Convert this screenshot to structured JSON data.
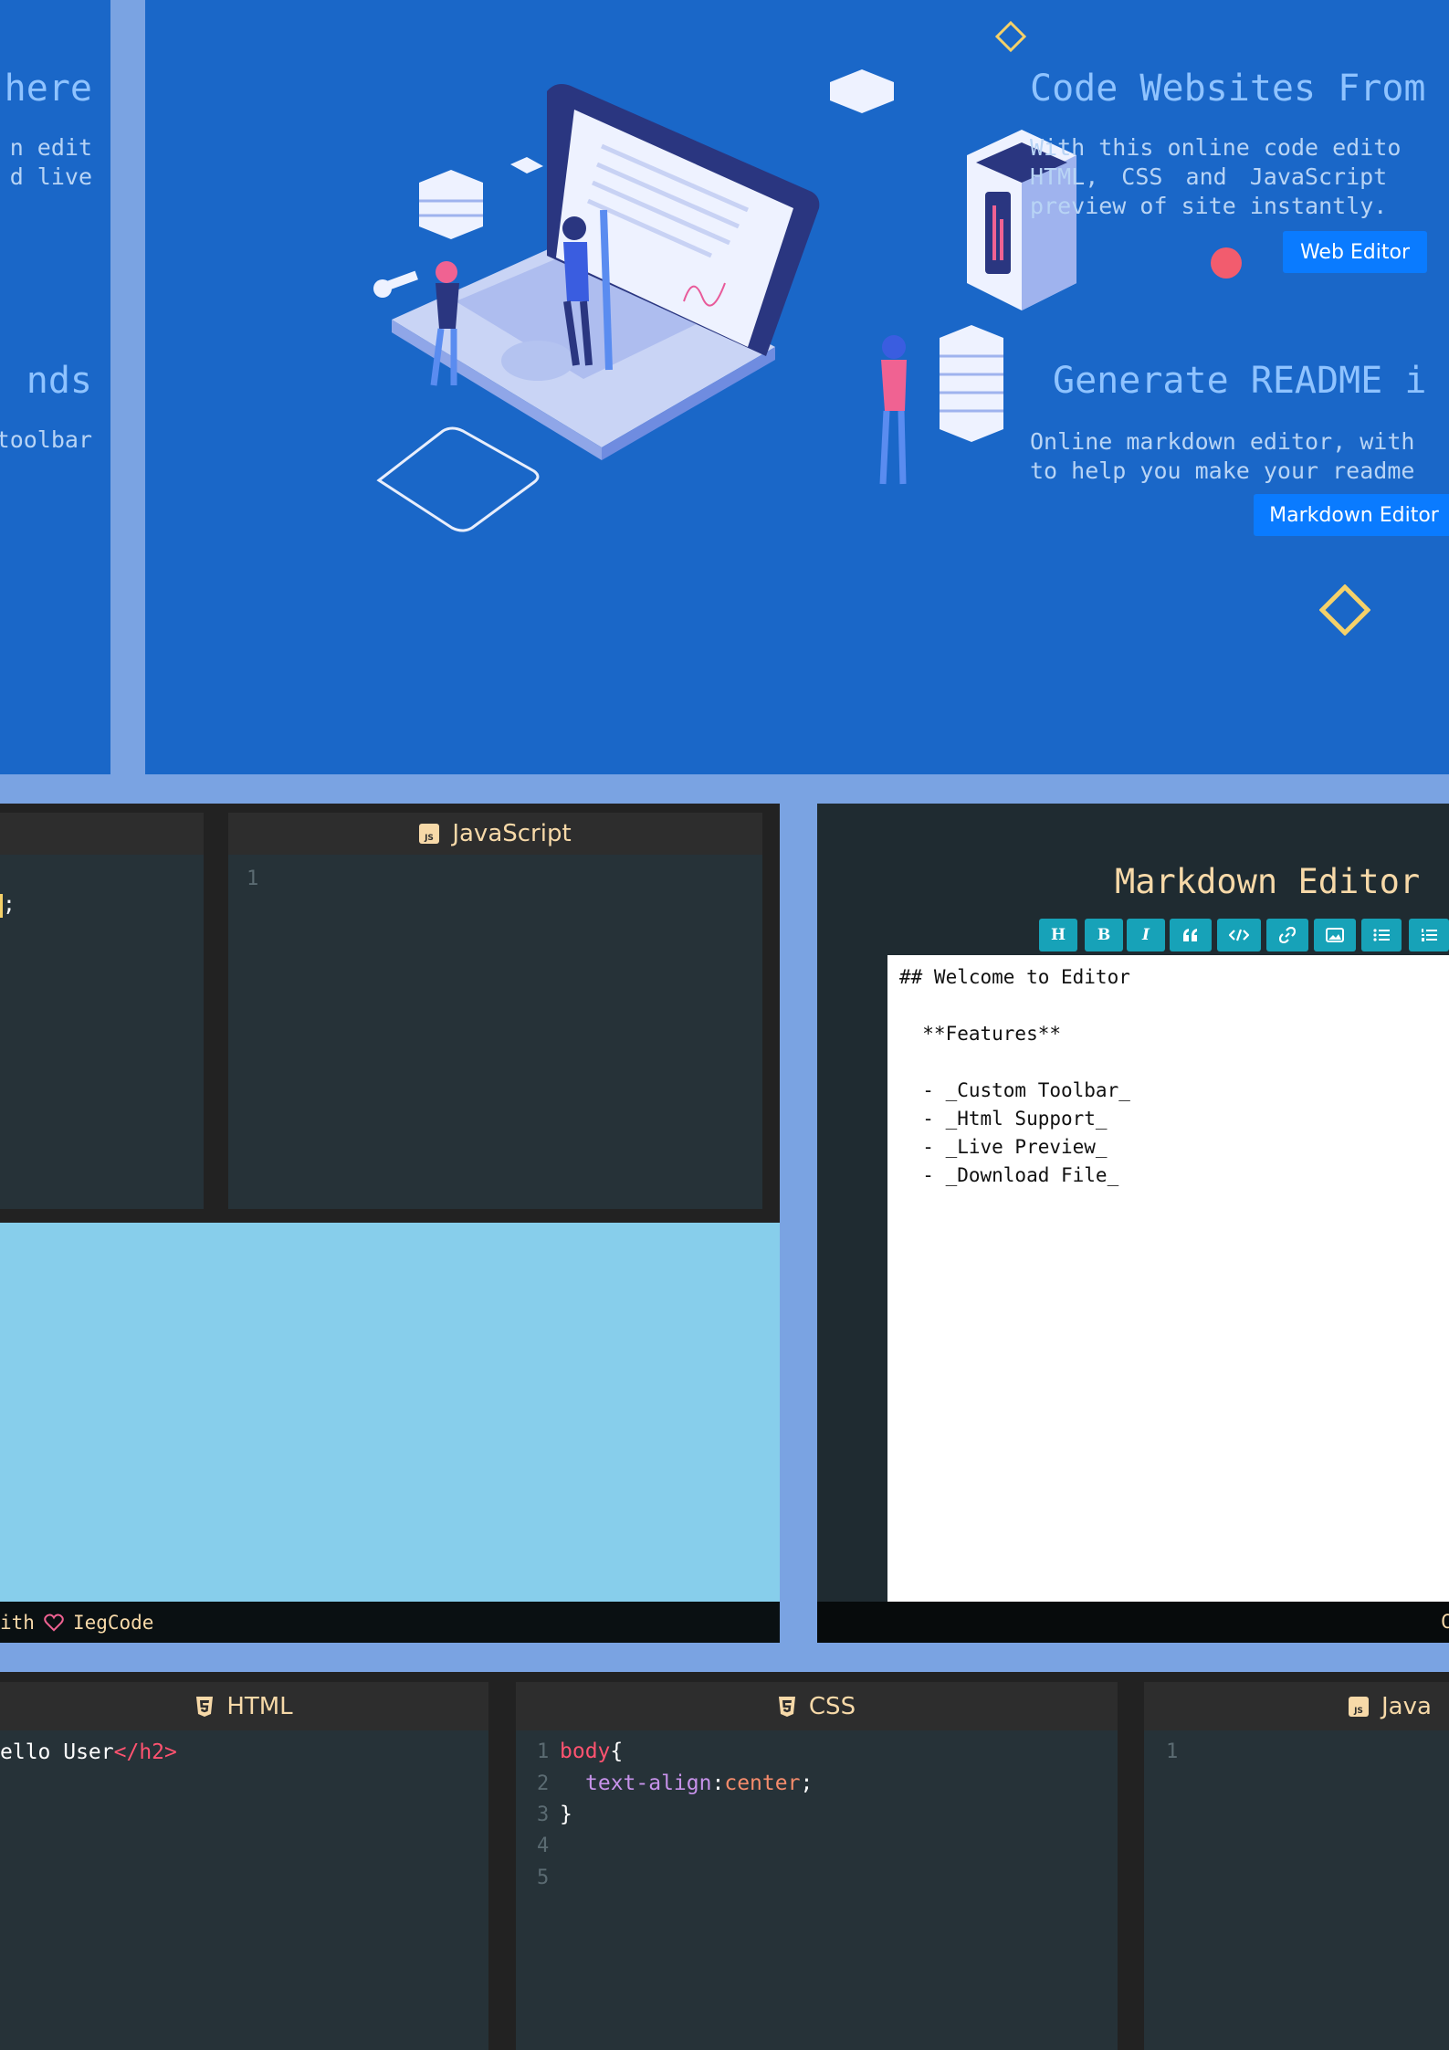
{
  "hero": {
    "left_title_1": "here",
    "left_text_1a": "n edit",
    "left_text_1b": "d live",
    "left_title_2": "nds",
    "left_text_2": "toolbar",
    "section1": {
      "title": "Code Websites From",
      "text_lines": [
        "With this online code edito",
        "HTML, CSS and JavaScript",
        "preview of site instantly."
      ],
      "button": "Web Editor"
    },
    "section2": {
      "title": "Generate README i",
      "text_lines": [
        "Online markdown editor, with",
        "to help you make your readme"
      ],
      "button": "Markdown Editor"
    }
  },
  "web_editor_preview": {
    "js_panel_title": "JavaScript",
    "js_line_numbers": [
      "1"
    ],
    "css_fragment": ";",
    "footer_prefix": "ith",
    "footer_author": "IegCode"
  },
  "markdown_editor": {
    "title": "Markdown Editor",
    "toolbar": [
      "H",
      "B",
      "I",
      "quote",
      "code",
      "link",
      "image",
      "ul",
      "ol"
    ],
    "content_lines": [
      "## Welcome to Editor",
      "",
      "  **Features**",
      "",
      "  - _Custom Toolbar_",
      "  - _Html Support_",
      "  - _Live Preview_",
      "  - _Download File_"
    ],
    "footer_fragment": "C"
  },
  "bottom_editor": {
    "html_title": "HTML",
    "html_code_text": "ello User",
    "html_code_tag": "</h2>",
    "css_title": "CSS",
    "css_line_numbers": [
      "1",
      "2",
      "3",
      "4",
      "5"
    ],
    "css_selector": "body",
    "css_open": "{",
    "css_property": "text-align",
    "css_colon": ":",
    "css_value": "center",
    "css_semicolon": ";",
    "css_close": "}",
    "js_title": "Java",
    "js_line_numbers": [
      "1"
    ]
  },
  "colors": {
    "hero_bg": "#1a67c8",
    "page_bg": "#7aa3e2",
    "button_blue": "#0a7bff",
    "toolbar_teal": "#17a2b8",
    "preview_bg": "#87ceeb",
    "accent_red": "#f25c6e",
    "accent_yellow": "#f5d169"
  }
}
